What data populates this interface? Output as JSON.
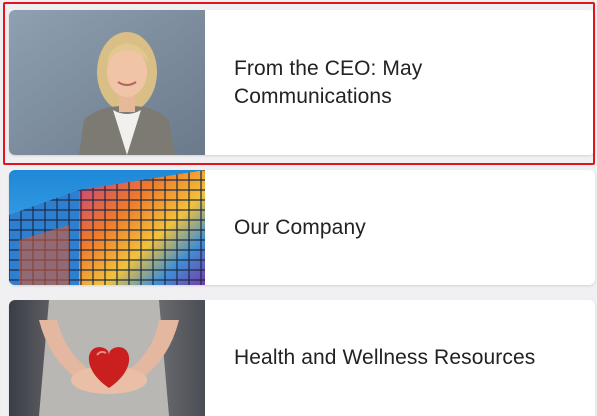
{
  "cards": [
    {
      "title": "From the CEO: May Communications",
      "image": "ceo-portrait"
    },
    {
      "title": "Our Company",
      "image": "glass-building"
    },
    {
      "title": "Health and Wellness Resources",
      "image": "heart-in-hands"
    }
  ],
  "colors": {
    "selection_border": "#e3141b",
    "card_background": "#ffffff",
    "page_background": "#f0f0f2"
  }
}
